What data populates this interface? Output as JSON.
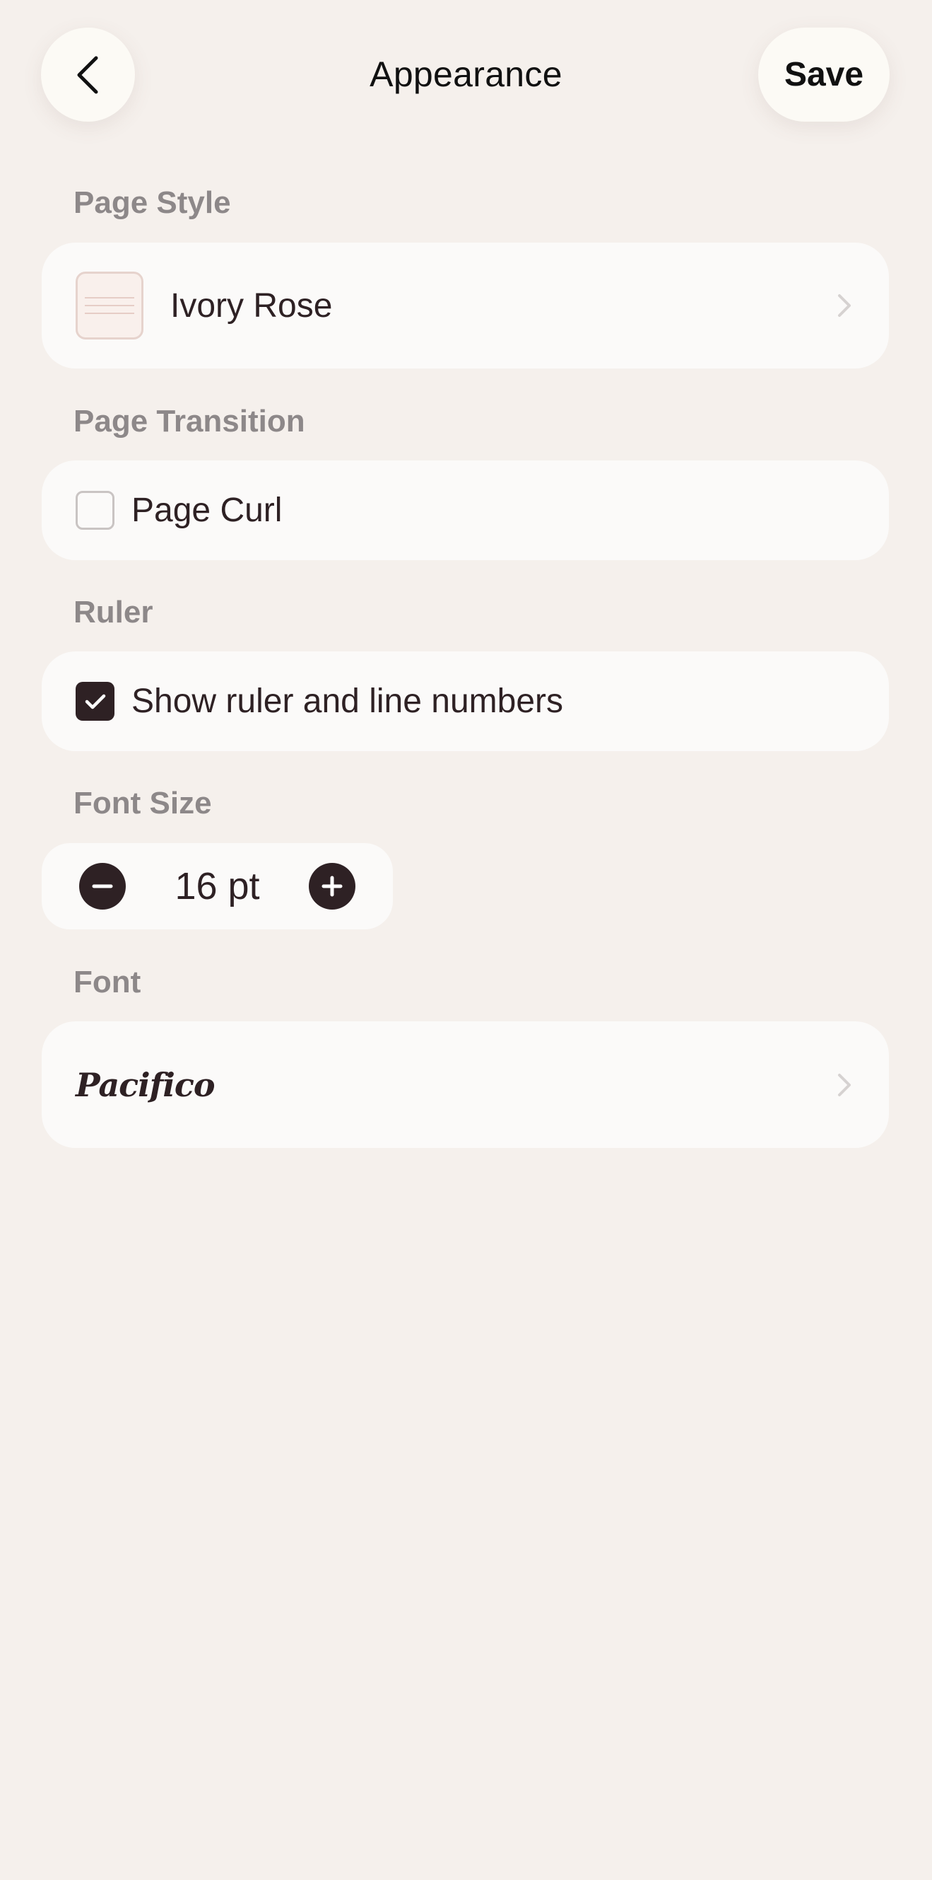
{
  "header": {
    "title": "Appearance",
    "save_label": "Save"
  },
  "sections": {
    "page_style": {
      "label": "Page Style",
      "value": "Ivory Rose"
    },
    "page_transition": {
      "label": "Page Transition",
      "option_label": "Page Curl",
      "checked": false
    },
    "ruler": {
      "label": "Ruler",
      "option_label": "Show ruler and line numbers",
      "checked": true
    },
    "font_size": {
      "label": "Font Size",
      "value": "16 pt"
    },
    "font": {
      "label": "Font",
      "value": "Pacifico"
    }
  },
  "colors": {
    "background": "#f5f0ec",
    "card": "#fbfaf9",
    "accent_dark": "#2e2124",
    "label_gray": "#8d8889"
  }
}
